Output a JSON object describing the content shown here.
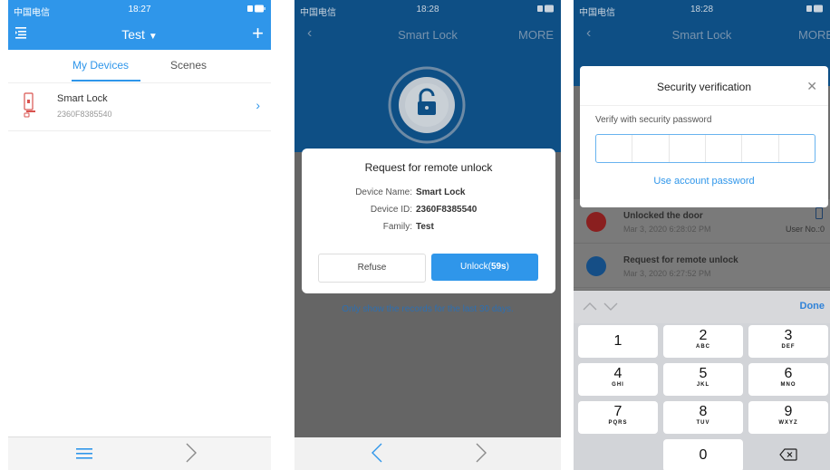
{
  "status_bars": [
    {
      "carrier": "中国电信",
      "time": "18:27"
    },
    {
      "carrier": "中国电信",
      "time": "18:28"
    },
    {
      "carrier": "中国电信",
      "time": "18:28"
    }
  ],
  "screen1": {
    "home_title": "Test",
    "tabs": [
      "My Devices",
      "Scenes"
    ],
    "device": {
      "name": "Smart Lock",
      "id": "2360F8385540"
    }
  },
  "screen2": {
    "nav_title": "Smart Lock",
    "more": "MORE",
    "dialog": {
      "title": "Request for remote unlock",
      "fields": [
        {
          "label": "Device Name:",
          "value": "Smart Lock"
        },
        {
          "label": "Device ID:",
          "value": "2360F8385540"
        },
        {
          "label": "Family:",
          "value": "Test"
        }
      ],
      "refuse": "Refuse",
      "unlock_prefix": "Unlock(",
      "unlock_count": "59s",
      "unlock_suffix": ")"
    },
    "records_note": "Only show the records for the last 30 days."
  },
  "screen3": {
    "nav_title": "Smart Lock",
    "more": "MORE",
    "dialog": {
      "title": "Security verification",
      "verify_label": "Verify with security password",
      "alt_link": "Use account password"
    },
    "records": [
      {
        "title": "Unlocked the door",
        "time": "Mar 3, 2020 6:28:02 PM",
        "user": "User No.:0",
        "color": "#8a1f1f"
      },
      {
        "title": "Request for remote unlock",
        "time": "Mar 3, 2020 6:27:52 PM",
        "user": "",
        "color": "#154e86"
      }
    ],
    "keyboard": {
      "done": "Done",
      "keys": [
        {
          "num": "1",
          "letters": ""
        },
        {
          "num": "2",
          "letters": "ABC"
        },
        {
          "num": "3",
          "letters": "DEF"
        },
        {
          "num": "4",
          "letters": "GHI"
        },
        {
          "num": "5",
          "letters": "JKL"
        },
        {
          "num": "6",
          "letters": "MNO"
        },
        {
          "num": "7",
          "letters": "PQRS"
        },
        {
          "num": "8",
          "letters": "TUV"
        },
        {
          "num": "9",
          "letters": "WXYZ"
        },
        {
          "num": "0",
          "letters": ""
        }
      ]
    }
  },
  "colors": {
    "accent": "#2f96ea",
    "header_dark": "#0e4f85",
    "lock_red": "#d9534f"
  }
}
